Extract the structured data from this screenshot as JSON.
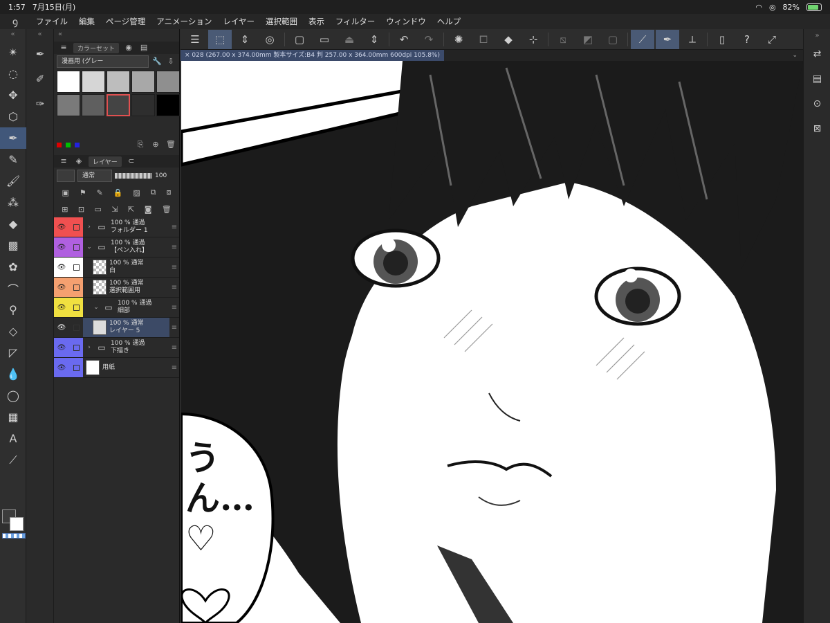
{
  "status": {
    "time": "1:57",
    "date": "7月15日(月)",
    "battery": "82%",
    "battery_level": 0.82
  },
  "menu": [
    "ファイル",
    "編集",
    "ページ管理",
    "アニメーション",
    "レイヤー",
    "選択範囲",
    "表示",
    "フィルター",
    "ウィンドウ",
    "ヘルプ"
  ],
  "tools": [
    "magic-wand-icon",
    "lasso-icon",
    "move-icon",
    "object-icon",
    "pen-icon",
    "pencil-icon",
    "brush-icon",
    "airbrush-icon",
    "fill-icon",
    "gradient-icon",
    "decoration-icon",
    "curve-icon",
    "eyedropper-icon",
    "eraser-icon",
    "frame-icon",
    "blend-icon",
    "balloon-icon",
    "panel-icon",
    "text-icon",
    "ruler-icon"
  ],
  "color_panel": {
    "tab_label": "カラーセット",
    "set_name": "漫画用 (グレー",
    "swatches": [
      "#ffffff",
      "#d6d6d6",
      "#bdbdbd",
      "#a8a8a8",
      "#8f8f8f",
      "#7a7a7a",
      "#5f5f5f",
      "#444444",
      "#2e2e2e",
      "#000000"
    ],
    "selected_index": 7
  },
  "layer_panel": {
    "tab_label": "レイヤー",
    "blend_mode": "通常",
    "opacity": "100",
    "layers": [
      {
        "color": "#f05050",
        "opacity": "100 %",
        "mode": "通過",
        "name": "フォルダー 1",
        "kind": "folder",
        "indent": 0,
        "expanded": false
      },
      {
        "color": "#b060e0",
        "opacity": "100 %",
        "mode": "通過",
        "name": "【ペン入れ】",
        "kind": "folder",
        "indent": 0,
        "expanded": true
      },
      {
        "color": "#ffffff",
        "opacity": "100 %",
        "mode": "通常",
        "name": "白",
        "kind": "raster",
        "indent": 1
      },
      {
        "color": "#f5a070",
        "opacity": "100 %",
        "mode": "通常",
        "name": "選択範囲用",
        "kind": "selection",
        "indent": 1
      },
      {
        "color": "#f0e040",
        "opacity": "100 %",
        "mode": "通過",
        "name": "細部",
        "kind": "folder",
        "indent": 1,
        "expanded": true
      },
      {
        "color": "#2a2a2a",
        "opacity": "100 %",
        "mode": "通常",
        "name": "レイヤー 5",
        "kind": "raster-face",
        "indent": 1,
        "active": true
      },
      {
        "color": "#6a6af0",
        "opacity": "100 %",
        "mode": "通過",
        "name": "下描き",
        "kind": "folder",
        "indent": 0,
        "expanded": false
      },
      {
        "color": "#6a6af0",
        "opacity": "",
        "mode": "",
        "name": "用紙",
        "kind": "paper",
        "indent": 0
      }
    ]
  },
  "toolbar": [
    "menu-icon",
    "edit-icon",
    "spinner-icon",
    "reference-icon",
    "new-page-icon",
    "open-icon",
    "export-icon",
    "undo-icon",
    "redo-icon",
    "loading-icon",
    "crop-icon",
    "fill-icon",
    "transform-icon",
    "clear-icon",
    "fill-selection-icon",
    "deselect-icon",
    "ruler-icon",
    "pen-ruler-icon",
    "snap-icon",
    "device-icon",
    "help-icon",
    "fullscreen-icon"
  ],
  "doc_tab": "× 028 (267.00 x 374.00mm 製本サイズ:B4 判 257.00 x 364.00mm 600dpi 105.8%)",
  "right_tools": [
    "sub-view-icon",
    "animation-icon",
    "navigator-icon",
    "close-panel-icon"
  ],
  "canvas": {
    "speech_text": "うん…♡"
  }
}
